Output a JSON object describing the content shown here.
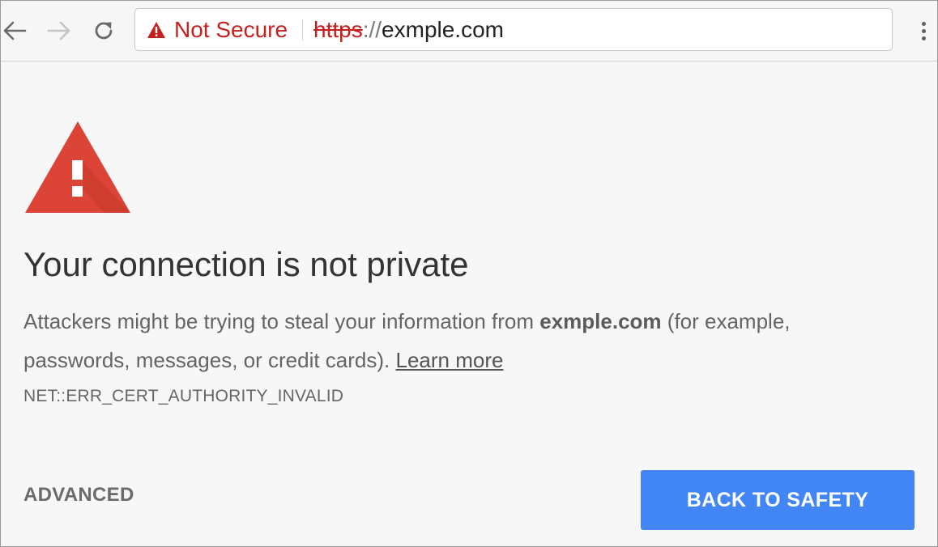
{
  "toolbar": {
    "back_icon": "arrow-left-icon",
    "forward_icon": "arrow-right-icon",
    "reload_icon": "reload-icon",
    "menu_icon": "vertical-dots-icon"
  },
  "omnibox": {
    "security_label": "Not Secure",
    "security_color": "#c5221f",
    "url_scheme": "https",
    "url_separator": "://",
    "url_host": "exmple.com"
  },
  "interstitial": {
    "heading": "Your connection is not private",
    "body_prefix": "Attackers might be trying to steal your information from ",
    "body_host": "exmple.com",
    "body_suffix": " (for example, passwords, messages, or credit cards). ",
    "learn_more": "Learn more",
    "error_code": "NET::ERR_CERT_AUTHORITY_INVALID",
    "advanced_label": "ADVANCED",
    "back_to_safety_label": "BACK TO SAFETY",
    "primary_color": "#4285f4",
    "warning_color": "#db4437"
  }
}
